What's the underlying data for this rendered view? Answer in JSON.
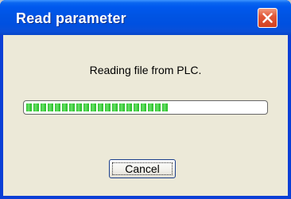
{
  "window": {
    "title": "Read parameter",
    "close_icon": "close-icon",
    "colors": {
      "titlebar": "#0054e3",
      "close_button": "#e2593b",
      "client_background": "#ece9d8",
      "progress_fill": "#2fc22f"
    }
  },
  "dialog": {
    "message": "Reading file from PLC.",
    "progress_fraction": 0.6,
    "cancel_label": "Cancel"
  }
}
